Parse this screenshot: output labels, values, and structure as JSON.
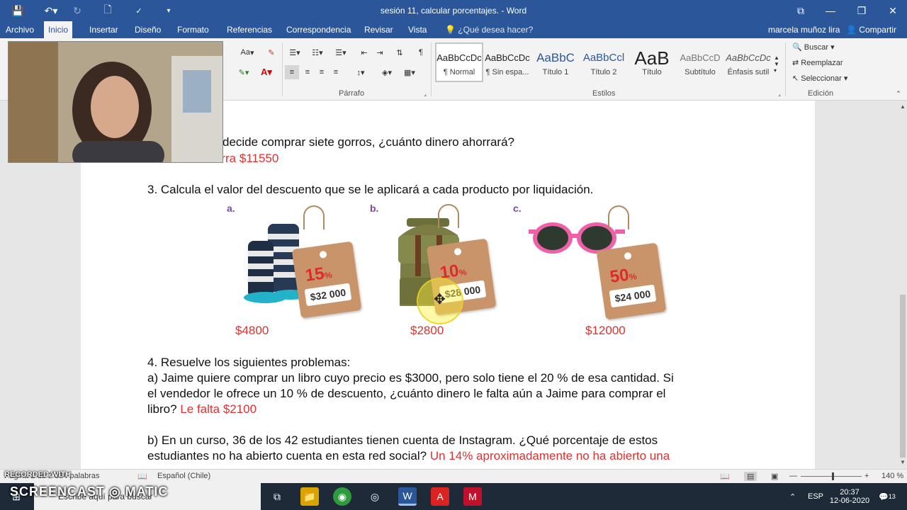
{
  "window": {
    "title": "sesión 11, calcular porcentajes. - Word",
    "controls": {
      "restore": "⧉",
      "minimize": "—",
      "maximize": "❐",
      "close": "✕"
    }
  },
  "tabs": [
    {
      "label": "Archivo"
    },
    {
      "label": "Inicio"
    },
    {
      "label": "Insertar"
    },
    {
      "label": "Diseño"
    },
    {
      "label": "Formato"
    },
    {
      "label": "Referencias"
    },
    {
      "label": "Correspondencia"
    },
    {
      "label": "Revisar"
    },
    {
      "label": "Vista"
    }
  ],
  "tell_me": "¿Qué desea hacer?",
  "user_name": "marcela muñoz lira",
  "share_label": "Compartir",
  "ribbon": {
    "font_size_btn": "Aa",
    "paragraph_label": "Párrafo",
    "styles_label": "Estilos",
    "editing_label": "Edición",
    "styles": [
      {
        "sample": "AaBbCcDc",
        "name": "¶ Normal"
      },
      {
        "sample": "AaBbCcDc",
        "name": "¶ Sin espa..."
      },
      {
        "sample": "AaBbC",
        "name": "Título 1"
      },
      {
        "sample": "AaBbCcl",
        "name": "Título 2"
      },
      {
        "sample": "AaB",
        "name": "Título"
      },
      {
        "sample": "AaBbCcD",
        "name": "Subtítulo"
      },
      {
        "sample": "AaBbCcDc",
        "name": "Énfasis sutil"
      }
    ],
    "find": "Buscar",
    "replace": "Reemplazar",
    "select": "Seleccionar"
  },
  "document": {
    "line_q2": "decide comprar siete gorros, ¿cuánto dinero ahorrará?",
    "answer_q2_partial": "ahorra $11550",
    "q3": "3. Calcula el valor del descuento que se le aplicará a cada producto por liquidación.",
    "products": [
      {
        "letter": "a.",
        "discount": "15",
        "tag_price": "$32 000",
        "answer": "$4800"
      },
      {
        "letter": "b.",
        "discount": "10",
        "tag_price": "$28 000",
        "answer": "$2800"
      },
      {
        "letter": "c.",
        "discount": "50",
        "tag_price": "$24 000",
        "answer": "$12000"
      }
    ],
    "pct_symbol": "%",
    "q4": "4. Resuelve los siguientes problemas:",
    "q4a_line1": "a) Jaime quiere comprar un libro cuyo precio es $3000, pero solo tiene el 20 % de esa cantidad. Si",
    "q4a_line2": "el vendedor le ofrece un 10 % de descuento, ¿cuánto dinero le falta aún a Jaime para comprar el",
    "q4a_line3": "libro?",
    "q4a_answer": "Le falta $2100",
    "q4b_line1": "b) En un curso, 36 de los 42 estudiantes tienen cuenta de Instagram. ¿Qué porcentaje de estos",
    "q4b_line2": "estudiantes no ha abierto cuenta en esta red social?",
    "q4b_answer": "Un 14% aproximadamente no ha abierto una"
  },
  "status": {
    "words": "Página 2 de 2   334 palabras",
    "language": "Español (Chile)",
    "zoom": "140 %"
  },
  "overlay": {
    "recorded_with": "RECORDED WITH",
    "screencast": "SCREENCAST",
    "matic": "MATIC"
  },
  "taskbar": {
    "search_placeholder": "Escribe aquí para buscar",
    "lang": "ESP",
    "time": "20:37",
    "date": "12-06-2020",
    "notifications": "13"
  }
}
